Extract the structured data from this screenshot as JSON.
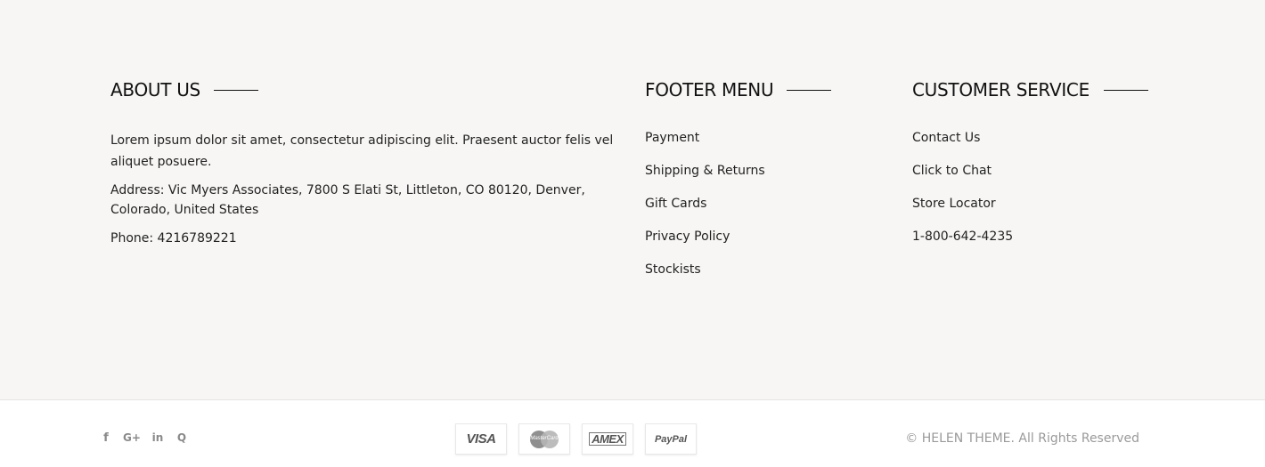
{
  "about": {
    "title": "ABOUT US",
    "text": "Lorem ipsum dolor sit amet, consectetur adipiscing elit. Praesent auctor felis vel aliquet posuere.",
    "address": "Address: Vic Myers Associates, 7800 S Elati St, Littleton, CO 80120, Denver, Colorado, United States",
    "phone": "Phone: 4216789221"
  },
  "footer_menu": {
    "title": "FOOTER MENU",
    "items": [
      {
        "label": "Payment"
      },
      {
        "label": "Shipping & Returns"
      },
      {
        "label": "Gift Cards"
      },
      {
        "label": "Privacy Policy"
      },
      {
        "label": "Stockists"
      }
    ]
  },
  "customer_service": {
    "title": "CUSTOMER SERVICE",
    "items": [
      {
        "label": "Contact Us"
      },
      {
        "label": "Click to Chat"
      },
      {
        "label": "Store Locator"
      },
      {
        "label": "1-800-642-4235"
      }
    ]
  },
  "social": {
    "icons": [
      "facebook-icon",
      "google-plus-icon",
      "linkedin-icon",
      "quora-icon"
    ],
    "facebook": "f",
    "google": "G+",
    "linkedin": "in",
    "quora": "Q"
  },
  "payments": {
    "visa": "VISA",
    "mastercard": "MasterCard",
    "amex": "AMEX",
    "paypal": "PayPal"
  },
  "copyright": "© HELEN THEME. All Rights Reserved",
  "colors": {
    "footer_bg": "#f7f6f4",
    "text": "#222222",
    "muted": "#9a9a9a"
  }
}
